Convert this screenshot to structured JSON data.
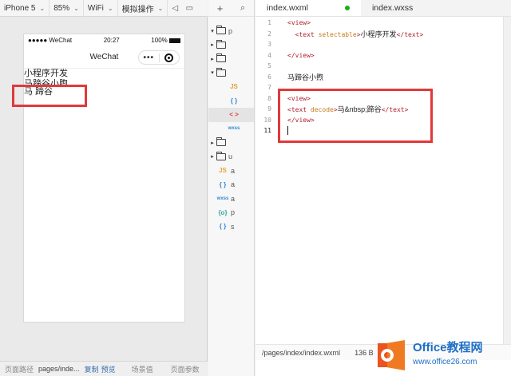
{
  "toolbar": {
    "device": "iPhone 5",
    "zoom": "85%",
    "network": "WiFi",
    "simulate": "模拟操作"
  },
  "phone": {
    "status_left": "●●●●● WeChat",
    "time": "20:27",
    "battery": "100%",
    "nav_title": "WeChat",
    "capsule_more": "•••",
    "content": [
      "小程序开发",
      "马蹄谷小煦",
      "马 蹄谷"
    ]
  },
  "sim_footer": {
    "path_label": "页面路径",
    "path_value": "pages/inde...",
    "copy": "复制",
    "preview": "预览",
    "scene": "场景值",
    "params": "页面参数"
  },
  "tree": {
    "items": [
      {
        "arrow": "▾",
        "type": "folder",
        "label": "p"
      },
      {
        "arrow": "▸",
        "type": "folder",
        "label": ""
      },
      {
        "arrow": "▸",
        "type": "folder",
        "label": ""
      },
      {
        "arrow": "▾",
        "type": "folder",
        "label": ""
      },
      {
        "arrow": "",
        "type": "js",
        "label": "JS"
      },
      {
        "arrow": "",
        "type": "json",
        "label": "{ }"
      },
      {
        "arrow": "",
        "type": "wxml",
        "label": "< >"
      },
      {
        "arrow": "",
        "type": "wxss",
        "label": "wxss"
      },
      {
        "arrow": "▸",
        "type": "folder",
        "label": ""
      },
      {
        "arrow": "▸",
        "type": "folder",
        "label": "u"
      },
      {
        "arrow": "",
        "type": "js",
        "label": "JS",
        "suffix": "a"
      },
      {
        "arrow": "",
        "type": "json",
        "label": "{ }",
        "suffix": "a"
      },
      {
        "arrow": "",
        "type": "wxss",
        "label": "wxss",
        "suffix": "a"
      },
      {
        "arrow": "",
        "type": "cfg",
        "label": "{o}",
        "suffix": "p"
      },
      {
        "arrow": "",
        "type": "json",
        "label": "{ }",
        "suffix": "s"
      }
    ]
  },
  "editor": {
    "tabs": [
      "index.wxml",
      "index.wxss"
    ],
    "lines": [
      {
        "n": "1",
        "html": "<span class='tag'>&lt;view&gt;</span>"
      },
      {
        "n": "2",
        "html": "  <span class='tag'>&lt;text</span> <span class='attr'>selectable</span><span class='tag'>&gt;</span><span class='txt'>小程序开发</span><span class='tag'>&lt;/text&gt;</span>"
      },
      {
        "n": "3",
        "html": ""
      },
      {
        "n": "4",
        "html": "<span class='tag'>&lt;/view&gt;</span>"
      },
      {
        "n": "5",
        "html": ""
      },
      {
        "n": "6",
        "html": "<span class='txt'>马蹄谷小煦</span>"
      },
      {
        "n": "7",
        "html": ""
      },
      {
        "n": "8",
        "html": "<span class='tag'>&lt;view&gt;</span>"
      },
      {
        "n": "9",
        "html": "<span class='tag'>&lt;text</span> <span class='attr'>decode</span><span class='tag'>&gt;</span><span class='txt'>马&amp;nbsp;蹄谷</span><span class='tag'>&lt;/text&gt;</span>"
      },
      {
        "n": "10",
        "html": "<span class='tag'>&lt;/view&gt;</span>"
      },
      {
        "n": "11",
        "html": "<span class='caret'></span>"
      }
    ],
    "status_path": "/pages/index/index.wxml",
    "status_size": "136 B"
  },
  "watermark": {
    "title": "Office教程网",
    "url": "www.office26.com"
  },
  "colors": {
    "highlight": "#e0393b",
    "saved_dot": "#1aad19",
    "brand_blue": "#1f6fc6"
  }
}
